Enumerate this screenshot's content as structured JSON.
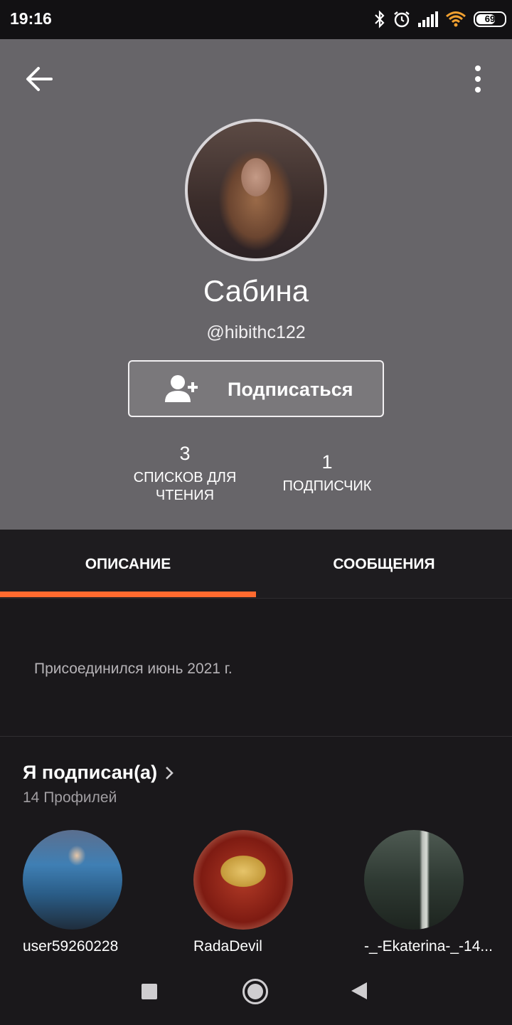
{
  "status_bar": {
    "time": "19:16",
    "battery": "69",
    "icons": [
      "bluetooth-icon",
      "alarm-icon",
      "signal-icon",
      "wifi-icon",
      "battery-icon"
    ]
  },
  "profile": {
    "name": "Сабина",
    "handle": "@hibithc122",
    "follow_label": "Подписаться",
    "stats": {
      "reading_lists_count": "3",
      "reading_lists_label": "СПИСКОВ ДЛЯ ЧТЕНИЯ",
      "followers_count": "1",
      "followers_label": "ПОДПИСЧИК"
    }
  },
  "tabs": [
    {
      "label": "ОПИСАНИЕ",
      "active": true
    },
    {
      "label": "СООБЩЕНИЯ",
      "active": false
    }
  ],
  "about": {
    "joined": "Присоединился июнь 2021 г."
  },
  "following": {
    "title": "Я подписан(а)",
    "count_text": "14 Профилей",
    "users": [
      {
        "name": "user59260228"
      },
      {
        "name": "RadaDevil"
      },
      {
        "name": "-_-Ekaterina-_-14..."
      }
    ]
  },
  "colors": {
    "header_bg": "#676569",
    "accent": "#ff6a2f",
    "page_bg": "#1a181b"
  }
}
